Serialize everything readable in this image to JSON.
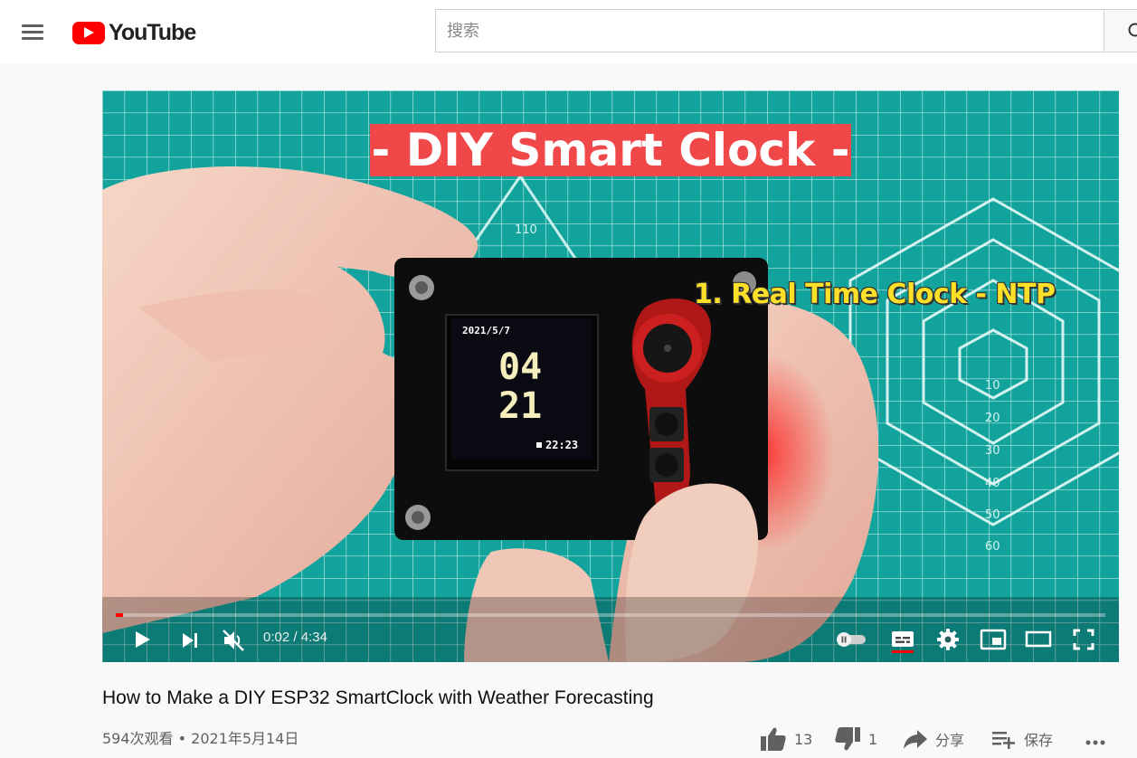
{
  "header": {
    "logo_text": "YouTube",
    "search_placeholder": "搜索"
  },
  "video": {
    "title_banner": "- DIY Smart Clock -",
    "overlay_caption": "1. Real Time Clock - NTP",
    "device_screen": {
      "date": "2021/5/7",
      "hour": "04",
      "minute": "21",
      "time": "22:23"
    }
  },
  "player": {
    "time_current": "0:02",
    "time_separator": " / ",
    "time_total": "4:34",
    "progress": 0.0073,
    "accent_color": "#ff0000"
  },
  "info": {
    "title": "How to Make a DIY ESP32 SmartClock with Weather Forecasting",
    "views": "594次观看",
    "separator": " • ",
    "date": "2021年5月14日",
    "likes": "13",
    "dislikes": "1",
    "share_label": "分享",
    "save_label": "保存"
  },
  "icons": {
    "menu": "hamburger-menu-icon",
    "search": "search-icon",
    "play": "play-icon",
    "next": "next-icon",
    "mute": "muted-volume-icon",
    "autoplay": "autoplay-toggle-icon",
    "subtitles": "subtitles-icon",
    "settings": "gear-icon",
    "miniplayer": "miniplayer-icon",
    "theater": "theater-mode-icon",
    "fullscreen": "fullscreen-icon",
    "like": "thumb-up-icon",
    "dislike": "thumb-down-icon",
    "share": "share-arrow-icon",
    "save": "playlist-add-icon",
    "more": "more-horizontal-icon"
  }
}
